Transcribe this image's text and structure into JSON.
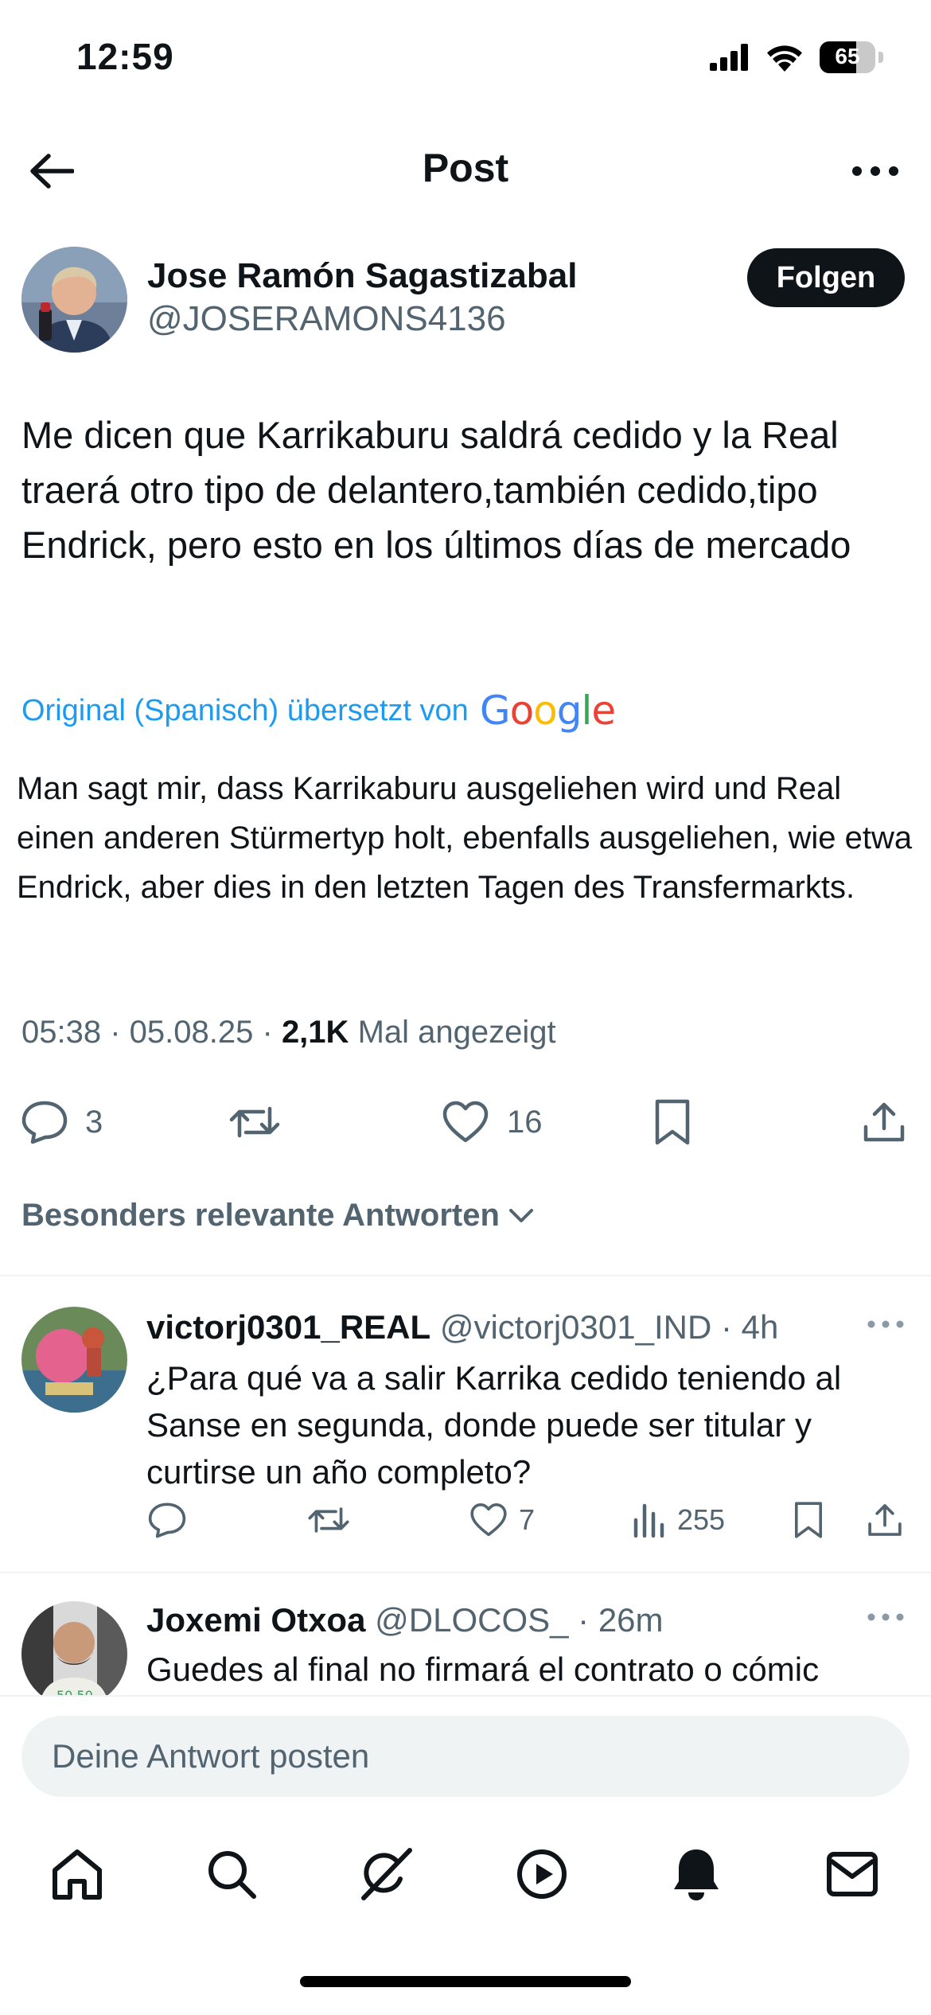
{
  "status_bar": {
    "time": "12:59",
    "battery": "65",
    "battery_level": 0.65
  },
  "header": {
    "title": "Post"
  },
  "author": {
    "name": "Jose Ramón Sagastizabal",
    "handle": "@JOSERAMONS4136",
    "follow_label": "Folgen"
  },
  "post": {
    "text": "Me dicen que Karrikaburu saldrá cedido y la Real traerá otro tipo de delantero,también cedido,tipo Endrick, pero esto en los últimos días de mercado",
    "translation_label": "Original (Spanisch) übersetzt von",
    "translation_provider": "Google",
    "translated_text": "Man sagt mir, dass Karrikaburu ausgeliehen wird und Real einen anderen Stürmertyp holt, ebenfalls ausgeliehen, wie etwa Endrick, aber dies in den letzten Tagen des Transfermarkts.",
    "time": "05:38",
    "date": "05.08.25",
    "views": "2,1K",
    "views_label": "Mal angezeigt",
    "replies": "3",
    "likes": "16"
  },
  "relevant_label": "Besonders relevante Antworten",
  "replies": [
    {
      "name": "victorj0301_REAL",
      "handle": "@victorj0301_IND",
      "time": "4h",
      "text": "¿Para qué va a salir Karrika cedido teniendo al Sanse en segunda, donde puede ser titular y curtirse un año completo?",
      "likes": "7",
      "views": "255"
    },
    {
      "name": "Joxemi Otxoa",
      "handle": "@DLOCOS_",
      "time": "26m",
      "text": "Guedes al final no firmará el contrato o cómic"
    }
  ],
  "composer": {
    "placeholder": "Deine Antwort posten"
  },
  "colors": {
    "accent": "#1d9bf0",
    "text": "#0f1419",
    "secondary": "#536471",
    "divider": "#eff3f4"
  },
  "tabbar": {
    "items": [
      "home-icon",
      "search-icon",
      "grok-icon",
      "video-icon",
      "notifications-icon",
      "messages-icon"
    ]
  }
}
